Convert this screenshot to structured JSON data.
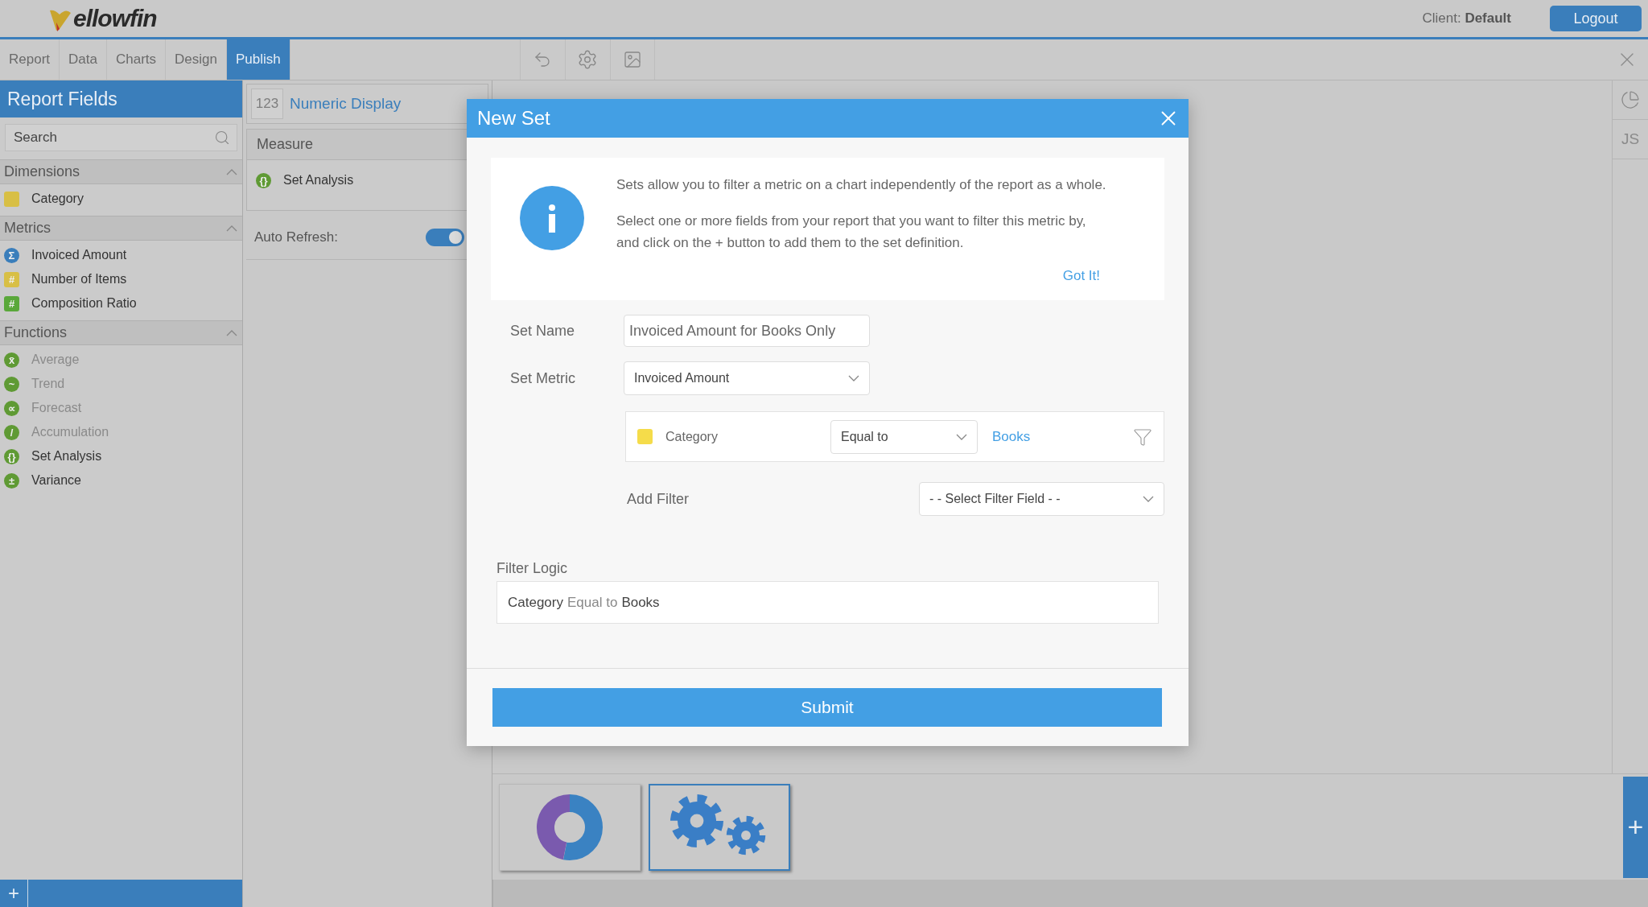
{
  "header": {
    "logo": "ellowfin",
    "client_label": "Client:",
    "client_name": "Default",
    "logout": "Logout"
  },
  "tabs": [
    {
      "label": "Report",
      "selected": false
    },
    {
      "label": "Data",
      "selected": false
    },
    {
      "label": "Charts",
      "selected": false
    },
    {
      "label": "Design",
      "selected": false
    },
    {
      "label": "Publish",
      "selected": true
    }
  ],
  "side_toolbar": {
    "js_label": "JS"
  },
  "report_fields": {
    "title": "Report Fields",
    "search_placeholder": "Search",
    "sections": [
      {
        "title": "Dimensions",
        "expanded": true,
        "items": [
          {
            "label": "Category",
            "color": "#d8bf45",
            "disabled": false
          }
        ]
      },
      {
        "title": "Metrics",
        "expanded": true,
        "items": [
          {
            "label": "Invoiced Amount",
            "glyph": "Σ",
            "kind": "circle",
            "color": "#3a7ebb",
            "disabled": false
          },
          {
            "label": "Number of Items",
            "glyph": "#",
            "kind": "square",
            "color": "#d8bf45",
            "disabled": false
          },
          {
            "label": "Composition Ratio",
            "glyph": "#",
            "kind": "square",
            "color": "#5aa83a",
            "disabled": false
          }
        ]
      },
      {
        "title": "Functions",
        "expanded": true,
        "items": [
          {
            "label": "Average",
            "glyph": "x̄",
            "kind": "circle",
            "color": "#5f9a34",
            "disabled": true
          },
          {
            "label": "Trend",
            "glyph": "~",
            "kind": "circle",
            "color": "#5f9a34",
            "disabled": true
          },
          {
            "label": "Forecast",
            "glyph": "∝",
            "kind": "circle",
            "color": "#5f9a34",
            "disabled": true
          },
          {
            "label": "Accumulation",
            "glyph": "/",
            "kind": "circle",
            "color": "#5f9a34",
            "disabled": true
          },
          {
            "label": "Set Analysis",
            "glyph": "{}",
            "kind": "circle",
            "color": "#5f9a34",
            "disabled": false
          },
          {
            "label": "Variance",
            "glyph": "±",
            "kind": "circle",
            "color": "#5f9a34",
            "disabled": false
          }
        ]
      }
    ],
    "add_label": "+"
  },
  "chart_panel": {
    "type_badge": "123",
    "type_name": "Numeric Display",
    "measure_title": "Measure",
    "measures": [
      {
        "glyph": "{}",
        "label": "Set Analysis",
        "color": "#5f9a34"
      }
    ],
    "auto_refresh_label": "Auto Refresh:",
    "auto_refresh_on": true
  },
  "dialog": {
    "title": "New Set",
    "info_paragraphs": [
      "Sets allow you to filter a metric on a chart independently of the report as a whole.",
      "Select one or more fields from your report that you want to filter this metric by, and click on the + button to add them to the set definition."
    ],
    "got_it": "Got It!",
    "set_name_label": "Set Name",
    "set_name_value": "Invoiced Amount for Books Only",
    "set_metric_label": "Set Metric",
    "set_metric_value": "Invoiced Amount",
    "filters": [
      {
        "field": "Category",
        "color": "#f5dc4a",
        "operator": "Equal to",
        "value": "Books"
      }
    ],
    "add_filter_label": "Add Filter",
    "add_filter_placeholder": "- - Select Filter Field - -",
    "filter_logic_label": "Filter Logic",
    "filter_logic": [
      {
        "text": "Category",
        "kind": "field"
      },
      {
        "text": "Equal to",
        "kind": "operator"
      },
      {
        "text": "Books",
        "kind": "value"
      }
    ],
    "submit": "Submit"
  },
  "thumbnails": [
    {
      "kind": "donut",
      "selected": false
    },
    {
      "kind": "gears",
      "selected": true
    }
  ],
  "add_chart_label": "+"
}
